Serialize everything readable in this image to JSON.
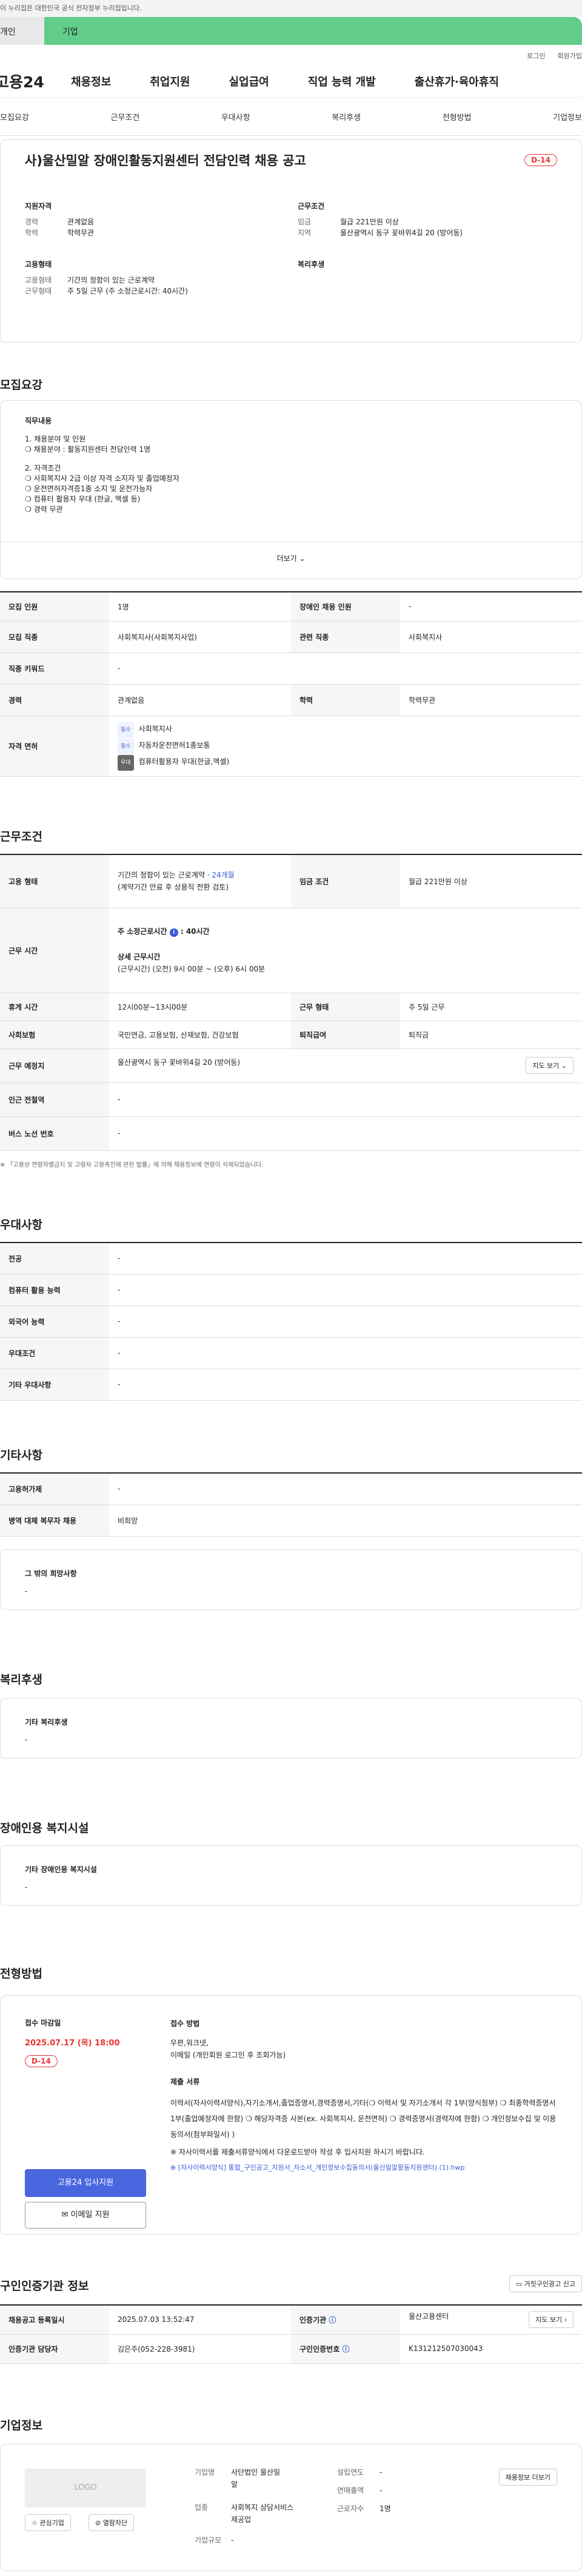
{
  "gov_banner": "이 누리집은 대한민국 공식 전자정부 누리집입니다.",
  "tabs": {
    "a": "개인",
    "b": "기업"
  },
  "util": [
    "로그인",
    "회원가입"
  ],
  "logo": "고용24",
  "gnb": [
    "채용정보",
    "취업지원",
    "실업급여",
    "직업 능력 개발",
    "출산휴가·육아휴직"
  ],
  "lnb": [
    "모집요강",
    "근무조건",
    "우대사항",
    "복리후생",
    "전형방법",
    "기업정보"
  ],
  "summary": {
    "title": "사)울산밀알 장애인활동지원센터 전담인력 채용 공고",
    "dday": "D-14",
    "qual_h": "지원자격",
    "career_l": "경력",
    "career_v": "관계없음",
    "edu_l": "학력",
    "edu_v": "학력무관",
    "cond_h": "근무조건",
    "wage_l": "임금",
    "wage_v": "월급 221만원 이상",
    "region_l": "지역",
    "region_v": "울산광역시 동구 꽃바위4길 20 (방어동)",
    "emp_h": "고용형태",
    "emp_l": "고용형태",
    "emp_v": "기간의 정함이 있는 근로계약",
    "work_l": "근무형태",
    "work_v": "주 5일 근무 (주 소정근로시간: 40시간)",
    "welfare_h": "복리후생"
  },
  "recruit": {
    "title": "모집요강",
    "duty_h": "직무내용",
    "lines": [
      "1. 채용분야 및 인원",
      "❍ 채용분야 : 활동지원센터 전담인력 1명",
      "",
      "2. 자격조건",
      "❍ 사회복지사 2급 이상 자격 소지자 및 졸업예정자",
      "❍ 운전면허자격증1종 소지 및 운전가능자",
      "❍ 컴퓨터 활용자 우대 (한글, 엑셀 등)",
      "❍ 경력 무관"
    ],
    "more": "더보기",
    "rows": {
      "cnt_l": "모집 인원",
      "cnt_v": "1명",
      "dis_l": "장애인 채용 인원",
      "dis_v": "-",
      "job_l": "모집 직종",
      "job_v": "사회복지사(사회복지사업)",
      "rel_l": "관련 직종",
      "rel_v": "사회복지사",
      "kw_l": "직종 키워드",
      "kw_v": "-",
      "car_l": "경력",
      "car_v": "관계없음",
      "edu_l": "학력",
      "edu_v": "학력무관",
      "lic_l": "자격 면허",
      "lic": [
        {
          "tag": "필수",
          "name": "사회복지사"
        },
        {
          "tag": "필수",
          "name": "자동차운전면허1종보통"
        },
        {
          "tag": "우대",
          "name": "컴퓨터활용자 우대(한글,엑셀)"
        }
      ]
    }
  },
  "cond": {
    "title": "근무조건",
    "emp_l": "고용 형태",
    "emp_v1": "기간의 정함이 있는 근로계약 · ",
    "emp_months": "24개월",
    "emp_v2": "(계약기간 만료 후 상용직 전환 검토)",
    "wage_l": "임금 조건",
    "wage_v": "월급 221만원 이상",
    "time_l": "근무 시간",
    "time_h1": "주 소정근로시간",
    "time_v1": ": 40시간",
    "time_h2": "상세 근무시간",
    "time_v2": "(근무시간) (오전) 9시 00분 ~ (오후) 6시 00분",
    "rest_l": "휴게 시간",
    "rest_v": "12시00분~13시00분",
    "form_l": "근무 형태",
    "form_v": "주 5일 근무",
    "ins_l": "사회보험",
    "ins_v": "국민연금, 고용보험, 산재보험, 건강보험",
    "ret_l": "퇴직급여",
    "ret_v": "퇴직금",
    "loc_l": "근무 예정지",
    "loc_v": "울산광역시 동구 꽃바위4길 20 (방어동)",
    "map_btn": "지도 보기",
    "sub_l": "인근 전철역",
    "sub_v": "-",
    "bus_l": "버스 노선 번호",
    "bus_v": "-",
    "note": "「고용상 연령차별금지 및 고령자 고용촉진에 관한 법률」에 의해 채용정보에 연령이 삭제되었습니다."
  },
  "pref": {
    "title": "우대사항",
    "rows": [
      [
        "전공",
        "-"
      ],
      [
        "컴퓨터 활용 능력",
        "-"
      ],
      [
        "외국어 능력",
        "-"
      ],
      [
        "우대조건",
        "-"
      ],
      [
        "기타 우대사항",
        "-"
      ]
    ]
  },
  "etc": {
    "title": "기타사항",
    "equip_l": "고용허가제",
    "equip_v": "-",
    "mil_l": "병역 대체 복무자 채용",
    "mil_v": "비희망",
    "other_h": "그 밖의 희망사항",
    "other_v": "-"
  },
  "welfare": {
    "title": "복리후생",
    "h": "기타 복리후생",
    "v": "-"
  },
  "facility": {
    "title": "장애인용 복지시설",
    "h": "기타 장애인용 복지시설",
    "v": "-"
  },
  "process": {
    "title": "전형방법",
    "deadline_h": "접수 마감일",
    "deadline": "2025.07.17 (목) 18:00",
    "dday": "D-14",
    "apply_btn": "고용24 입사지원",
    "mail_btn": "이메일 지원",
    "method_h": "접수 방법",
    "method_v1": "우편,워크넷,",
    "method_v2": "이메일 (개인회원 로그인 후 조회가능)",
    "docs_h": "제출 서류",
    "docs_v": "이력서(자사이력서양식),자기소개서,졸업증명서,경력증명서,기타(❍ 이력서 및 자기소개서 각 1부(양식첨부) ❍ 최종학력증명서 1부(졸업예정자에 한함) ❍ 해당자격증 사본(ex. 사회복지사, 운전면허) ❍ 경력증명서(경력자에 한함) ❍ 개인정보수집 및 이용동의서(첨부파일서) )",
    "docs_note": "※ 자사이력서를 제출서류양식에서 다운로드받아 작성 후 입사지원 하시기 바랍니다.",
    "file": "[자사이력서양식] 통합_구인공고_지원서_자소서_개인정보수집동의서(울산밀알활동지원센터) (1).hwp"
  },
  "info": {
    "title": "구인인증기관 정보",
    "report_btn": "거짓구인광고 신고",
    "reg_l": "채용공고 등록일시",
    "reg_v": "2025.07.03 13:52:47",
    "org_l": "인증기관",
    "org_v": "울산고용센터",
    "map_btn": "지도 보기",
    "mgr_l": "인증기관 담당자",
    "mgr_v": "김은주(052-228-3981)",
    "no_l": "구인인증번호",
    "no_v": "K131212507030043"
  },
  "company": {
    "title": "기업정보",
    "logo": "LOGO",
    "fav_btn": "관심기업",
    "block_btn": "열람차단",
    "type_l": "기업명",
    "type_v": "사단법인 울산밀알",
    "ind_l": "업종",
    "ind_v": "사회복지 상담서비스 제공업",
    "size_l": "기업규모",
    "size_v": "-",
    "est_l": "설립연도",
    "est_v": "-",
    "sales_l": "연매출액",
    "sales_v": "-",
    "emp_l": "근로자수",
    "emp_v": "1명",
    "more_btn": "채용정보 더보기"
  },
  "colors": {
    "accent": "#3a5bd9",
    "dday": "#e33333",
    "green_tab": "#62cc8a"
  }
}
